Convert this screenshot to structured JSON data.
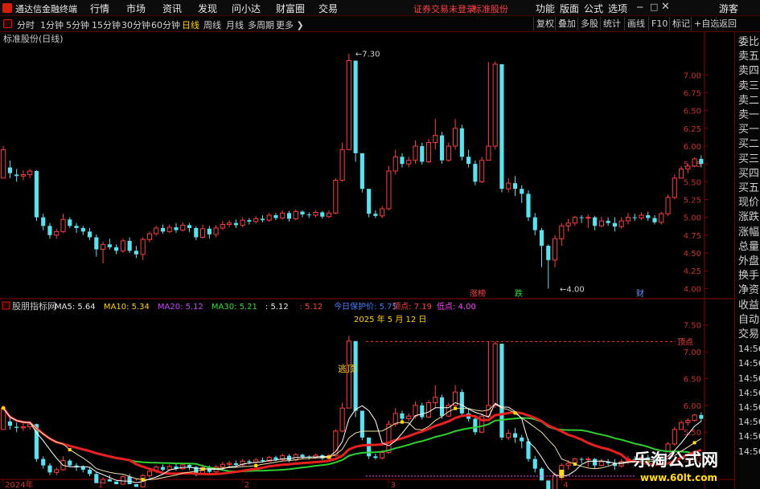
{
  "window": {
    "app_name": "通达信金融终端",
    "menu": [
      "行情",
      "市场",
      "资讯",
      "发现",
      "问小达",
      "财富圈",
      "交易"
    ],
    "login_status": "证券交易未登录",
    "stock_name": "标准股份",
    "right_menu": [
      "功能",
      "版面",
      "公式",
      "选项"
    ],
    "guest": "游客"
  },
  "periods": [
    "分时",
    "1分钟",
    "5分钟",
    "15分钟",
    "30分钟",
    "60分钟",
    "日线",
    "周线",
    "月线",
    "多周期",
    "更多"
  ],
  "active_period": "日线",
  "toolbar_buttons": [
    "复权",
    "叠加",
    "多股",
    "统计",
    "画线",
    "F10",
    "标记",
    "+自选",
    "返回"
  ],
  "right_panel": [
    "委比",
    "卖五",
    "卖四",
    "卖三",
    "卖二",
    "卖一",
    "买一",
    "买二",
    "买三",
    "买四",
    "买五",
    "现价",
    "涨跌",
    "涨幅",
    "总量",
    "外盘",
    "换手",
    "净资",
    "收益",
    "自动",
    "交易",
    "14:56",
    "14:56",
    "14:56",
    "14:56",
    "14:56",
    "14:56",
    "14:56",
    "14:56"
  ],
  "main_panel": {
    "title": "标准股份(日线)",
    "markers": [
      "涨榜",
      "跌",
      "财"
    ],
    "high_label": "7.30",
    "low_label": "4.00"
  },
  "indicator_panel": {
    "name": "股朋指标网",
    "legend": [
      {
        "label": "MA5: 5.64",
        "color": "#e8e8e8"
      },
      {
        "label": "MA10: 5.34",
        "color": "#ffd200"
      },
      {
        "label": "MA20: 5.12",
        "color": "#d040ff"
      },
      {
        "label": "MA30: 5.21",
        "color": "#30e030"
      },
      {
        "label": ": 5.12",
        "color": "#e8e8e8"
      },
      {
        "label": ": 5.12",
        "color": "#ff4040"
      },
      {
        "label": "今日保护价: 5.75",
        "color": "#4080ff"
      },
      {
        "label": "顶点: 7.19",
        "color": "#ff4040"
      },
      {
        "label": "低点: 4.00",
        "color": "#ff40ff"
      }
    ],
    "date_note": "2025 年 5 月 12 日",
    "escape_label": "逃顶",
    "peak_label": "顶点"
  },
  "watermark": {
    "brand": "乐淘公式网",
    "site": "www.60lt.com"
  },
  "chart_data": {
    "type": "candlestick",
    "title": "标准股份(日线)",
    "y_ticks_main": [
      "7.00",
      "6.75",
      "6.50",
      "6.25",
      "6.00",
      "5.75",
      "5.50",
      "5.25",
      "5.00",
      "4.75",
      "4.50",
      "4.25",
      "4.00"
    ],
    "y_ticks_indicator": [
      "7.50",
      "7.00",
      "6.50",
      "6.00",
      "5.50",
      "5.00"
    ],
    "ylim_main": [
      3.88,
      7.42
    ],
    "ylim_indicator": [
      4.62,
      7.75
    ],
    "x_labels": [
      {
        "i": 0,
        "label": "2024年"
      },
      {
        "i": 14,
        "label": "1"
      },
      {
        "i": 36,
        "label": "2"
      },
      {
        "i": 58,
        "label": "3"
      },
      {
        "i": 84,
        "label": "4"
      }
    ],
    "candles": [
      [
        5.55,
        5.95,
        6.0,
        5.55
      ],
      [
        5.7,
        5.62,
        5.8,
        5.55
      ],
      [
        5.6,
        5.58,
        5.68,
        5.5
      ],
      [
        5.58,
        5.6,
        5.66,
        5.52
      ],
      [
        5.6,
        5.65,
        5.68,
        5.55
      ],
      [
        5.65,
        5.0,
        5.66,
        4.95
      ],
      [
        5.0,
        4.88,
        5.05,
        4.82
      ],
      [
        4.88,
        4.75,
        4.92,
        4.7
      ],
      [
        4.75,
        4.8,
        4.84,
        4.7
      ],
      [
        4.8,
        4.97,
        5.05,
        4.78
      ],
      [
        4.97,
        4.88,
        5.0,
        4.85
      ],
      [
        4.88,
        4.85,
        4.92,
        4.78
      ],
      [
        4.85,
        4.8,
        4.88,
        4.75
      ],
      [
        4.8,
        4.72,
        4.85,
        4.68
      ],
      [
        4.72,
        4.55,
        4.76,
        4.45
      ],
      [
        4.55,
        4.62,
        4.66,
        4.35
      ],
      [
        4.62,
        4.58,
        4.7,
        4.55
      ],
      [
        4.58,
        4.53,
        4.62,
        4.48
      ],
      [
        4.53,
        4.67,
        4.7,
        4.5
      ],
      [
        4.67,
        4.53,
        4.72,
        4.5
      ],
      [
        4.53,
        4.48,
        4.6,
        4.43
      ],
      [
        4.48,
        4.69,
        4.72,
        4.4
      ],
      [
        4.69,
        4.77,
        4.8,
        4.65
      ],
      [
        4.77,
        4.85,
        4.88,
        4.74
      ],
      [
        4.85,
        4.8,
        4.9,
        4.77
      ],
      [
        4.8,
        4.86,
        4.9,
        4.78
      ],
      [
        4.86,
        4.82,
        4.92,
        4.78
      ],
      [
        4.82,
        4.89,
        4.93,
        4.8
      ],
      [
        4.89,
        4.85,
        4.92,
        4.79
      ],
      [
        4.85,
        4.72,
        4.87,
        4.68
      ],
      [
        4.72,
        4.84,
        4.9,
        4.7
      ],
      [
        4.84,
        4.76,
        4.88,
        4.7
      ],
      [
        4.76,
        4.85,
        4.89,
        4.72
      ],
      [
        4.85,
        4.9,
        4.95,
        4.82
      ],
      [
        4.9,
        4.92,
        4.96,
        4.86
      ],
      [
        4.92,
        4.89,
        4.97,
        4.85
      ],
      [
        4.89,
        4.96,
        5.0,
        4.86
      ],
      [
        4.96,
        4.94,
        4.99,
        4.9
      ],
      [
        4.94,
        4.98,
        5.02,
        4.91
      ],
      [
        4.98,
        4.96,
        5.03,
        4.93
      ],
      [
        4.96,
        5.03,
        5.06,
        4.94
      ],
      [
        5.03,
        4.99,
        5.06,
        4.96
      ],
      [
        4.99,
        5.06,
        5.1,
        4.97
      ],
      [
        5.06,
        4.98,
        5.09,
        4.94
      ],
      [
        4.98,
        5.08,
        5.11,
        4.96
      ],
      [
        5.08,
        5.04,
        5.1,
        5.0
      ],
      [
        5.04,
        5.03,
        5.07,
        4.99
      ],
      [
        5.03,
        5.07,
        5.1,
        5.0
      ],
      [
        5.07,
        5.01,
        5.09,
        4.98
      ],
      [
        5.01,
        5.06,
        5.1,
        4.99
      ],
      [
        5.06,
        5.52,
        5.55,
        5.04
      ],
      [
        5.52,
        5.95,
        6.05,
        5.5
      ],
      [
        5.95,
        7.2,
        7.3,
        6.3
      ],
      [
        7.2,
        5.9,
        5.95,
        5.78
      ],
      [
        5.9,
        5.4,
        5.45,
        5.35
      ],
      [
        5.4,
        5.05,
        5.08,
        5.0
      ],
      [
        5.05,
        5.02,
        5.1,
        4.99
      ],
      [
        5.02,
        5.12,
        5.16,
        4.99
      ],
      [
        5.12,
        5.65,
        5.72,
        5.1
      ],
      [
        5.65,
        5.85,
        5.95,
        5.6
      ],
      [
        5.85,
        5.75,
        5.9,
        5.7
      ],
      [
        5.75,
        5.8,
        5.85,
        5.7
      ],
      [
        5.8,
        6.0,
        6.08,
        5.75
      ],
      [
        6.0,
        5.78,
        6.05,
        5.74
      ],
      [
        5.78,
        6.05,
        6.1,
        5.76
      ],
      [
        6.05,
        6.15,
        6.38,
        5.95
      ],
      [
        6.15,
        5.8,
        6.2,
        5.75
      ],
      [
        5.8,
        6.0,
        6.05,
        5.78
      ],
      [
        6.0,
        6.25,
        6.38,
        5.95
      ],
      [
        6.25,
        5.85,
        6.3,
        5.8
      ],
      [
        5.85,
        5.75,
        5.95,
        5.7
      ],
      [
        5.75,
        5.5,
        5.8,
        5.45
      ],
      [
        5.5,
        5.8,
        5.85,
        5.48
      ],
      [
        5.8,
        6.0,
        7.18,
        5.8
      ],
      [
        6.0,
        7.15,
        7.19,
        5.95
      ],
      [
        7.15,
        5.4,
        6.1,
        5.35
      ],
      [
        5.4,
        5.48,
        5.55,
        5.35
      ],
      [
        5.48,
        5.4,
        5.58,
        5.3
      ],
      [
        5.4,
        5.33,
        5.45,
        5.2
      ],
      [
        5.33,
        5.0,
        5.38,
        4.95
      ],
      [
        5.0,
        4.82,
        5.06,
        4.75
      ],
      [
        4.82,
        4.6,
        4.85,
        4.3
      ],
      [
        4.6,
        4.4,
        4.62,
        4.0
      ],
      [
        4.4,
        4.7,
        4.75,
        4.3
      ],
      [
        4.7,
        4.88,
        4.92,
        4.6
      ],
      [
        4.88,
        4.92,
        4.98,
        4.8
      ],
      [
        4.92,
        5.0,
        5.02,
        4.88
      ],
      [
        5.0,
        4.99,
        5.03,
        4.92
      ],
      [
        4.99,
        5.0,
        5.04,
        4.85
      ],
      [
        5.0,
        4.88,
        5.02,
        4.82
      ],
      [
        4.88,
        4.95,
        5.01,
        4.86
      ],
      [
        4.95,
        4.92,
        5.0,
        4.88
      ],
      [
        4.92,
        4.87,
        5.0,
        4.8
      ],
      [
        4.87,
        4.95,
        5.0,
        4.84
      ],
      [
        4.95,
        5.0,
        5.06,
        4.9
      ],
      [
        5.0,
        4.99,
        5.05,
        4.95
      ],
      [
        4.99,
        5.03,
        5.07,
        4.96
      ],
      [
        5.03,
        4.99,
        5.08,
        4.95
      ],
      [
        4.99,
        4.93,
        5.03,
        4.9
      ],
      [
        4.93,
        5.05,
        5.08,
        4.9
      ],
      [
        5.05,
        5.28,
        5.32,
        5.02
      ],
      [
        5.28,
        5.55,
        5.6,
        5.25
      ],
      [
        5.55,
        5.68,
        5.72,
        5.55
      ],
      [
        5.68,
        5.72,
        5.76,
        5.62
      ],
      [
        5.72,
        5.82,
        5.84,
        5.7
      ],
      [
        5.82,
        5.75,
        5.87,
        5.7
      ]
    ],
    "ma_lines_note": "MA overlays (white MA5, yellow MA10, red MA20, green MA30) computed from closes"
  }
}
